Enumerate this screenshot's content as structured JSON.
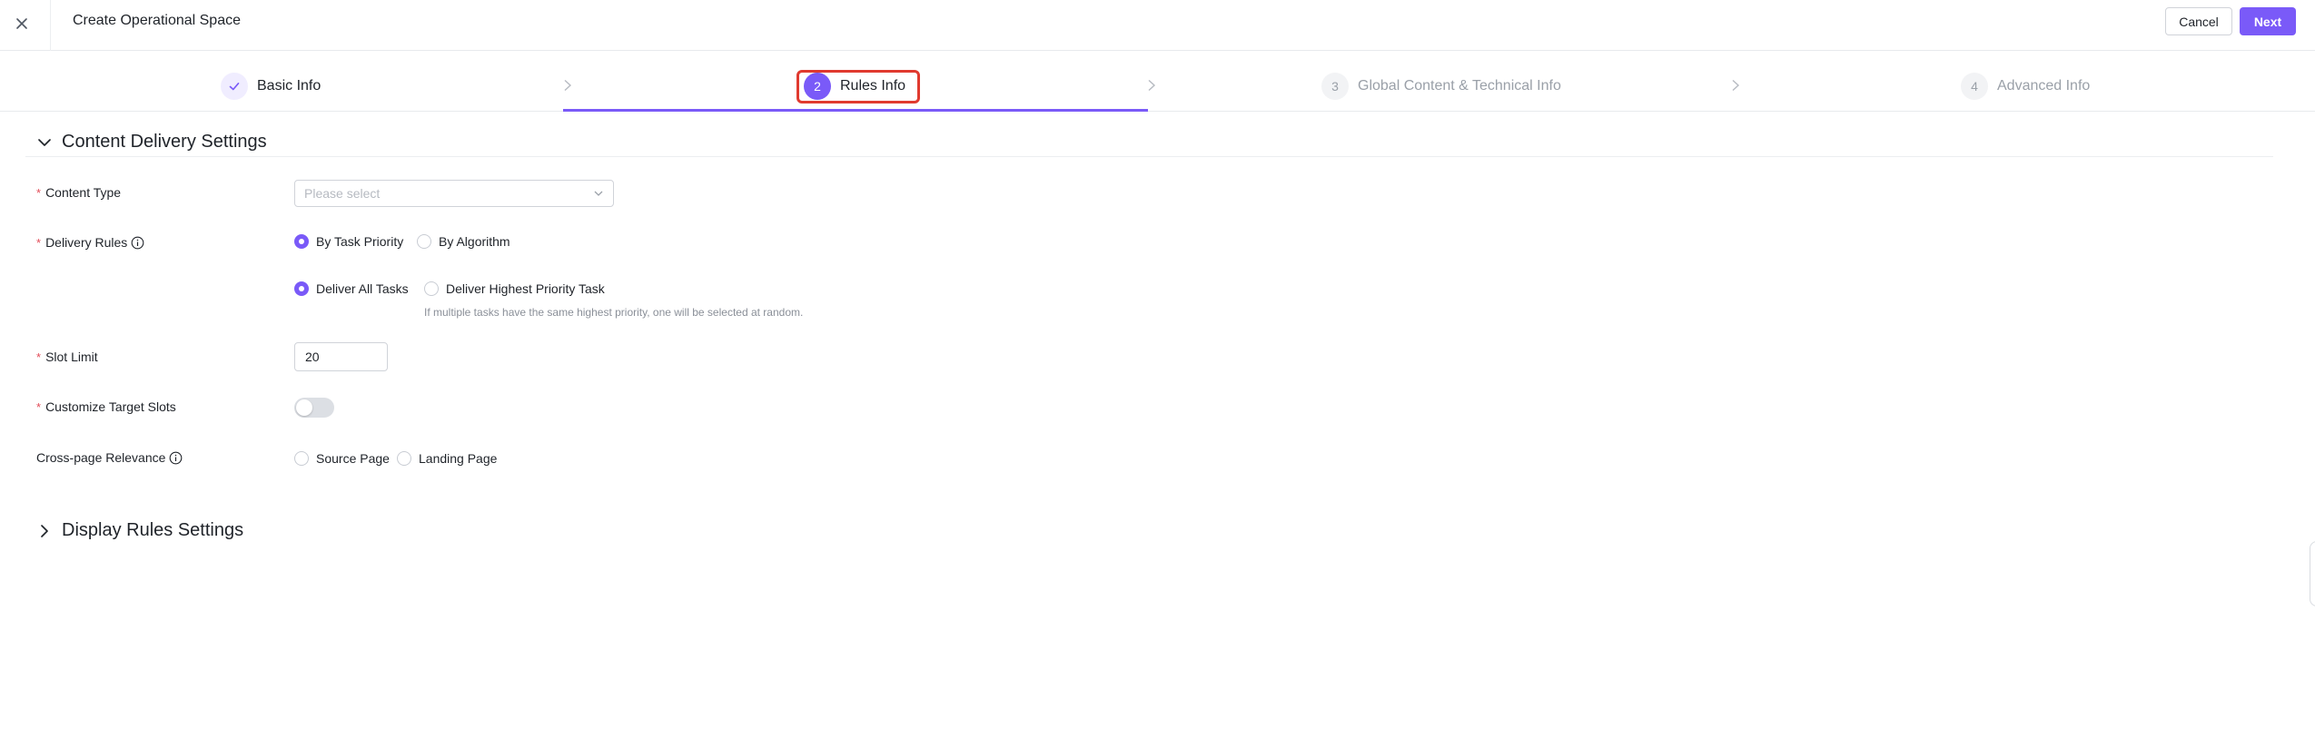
{
  "header": {
    "title": "Create Operational Space",
    "cancel_label": "Cancel",
    "next_label": "Next"
  },
  "steps": [
    {
      "number": "",
      "label": "Basic Info",
      "state": "done"
    },
    {
      "number": "2",
      "label": "Rules Info",
      "state": "active"
    },
    {
      "number": "3",
      "label": "Global Content & Technical Info",
      "state": "todo"
    },
    {
      "number": "4",
      "label": "Advanced Info",
      "state": "todo"
    }
  ],
  "content_delivery": {
    "title": "Content Delivery Settings",
    "expanded": true,
    "content_type": {
      "label": "Content Type",
      "required": true,
      "placeholder": "Please select"
    },
    "delivery_rules": {
      "label": "Delivery Rules",
      "required": true,
      "options": [
        "By Task Priority",
        "By Algorithm"
      ],
      "selected": "By Task Priority",
      "sub_options": [
        "Deliver All Tasks",
        "Deliver Highest Priority Task"
      ],
      "sub_selected": "Deliver All Tasks",
      "hint": "If multiple tasks have the same highest priority, one will be selected at random."
    },
    "slot_limit": {
      "label": "Slot Limit",
      "required": true,
      "value": "20"
    },
    "customize_target_slots": {
      "label": "Customize Target Slots",
      "required": true,
      "enabled": false
    },
    "cross_page_relevance": {
      "label": "Cross-page Relevance",
      "required": false,
      "options": [
        "Source Page",
        "Landing Page"
      ],
      "selected": ""
    }
  },
  "display_rules": {
    "title": "Display Rules Settings",
    "expanded": false
  },
  "colors": {
    "accent": "#7a5af8",
    "highlight": "#e03a2f",
    "required": "#e34d59"
  }
}
